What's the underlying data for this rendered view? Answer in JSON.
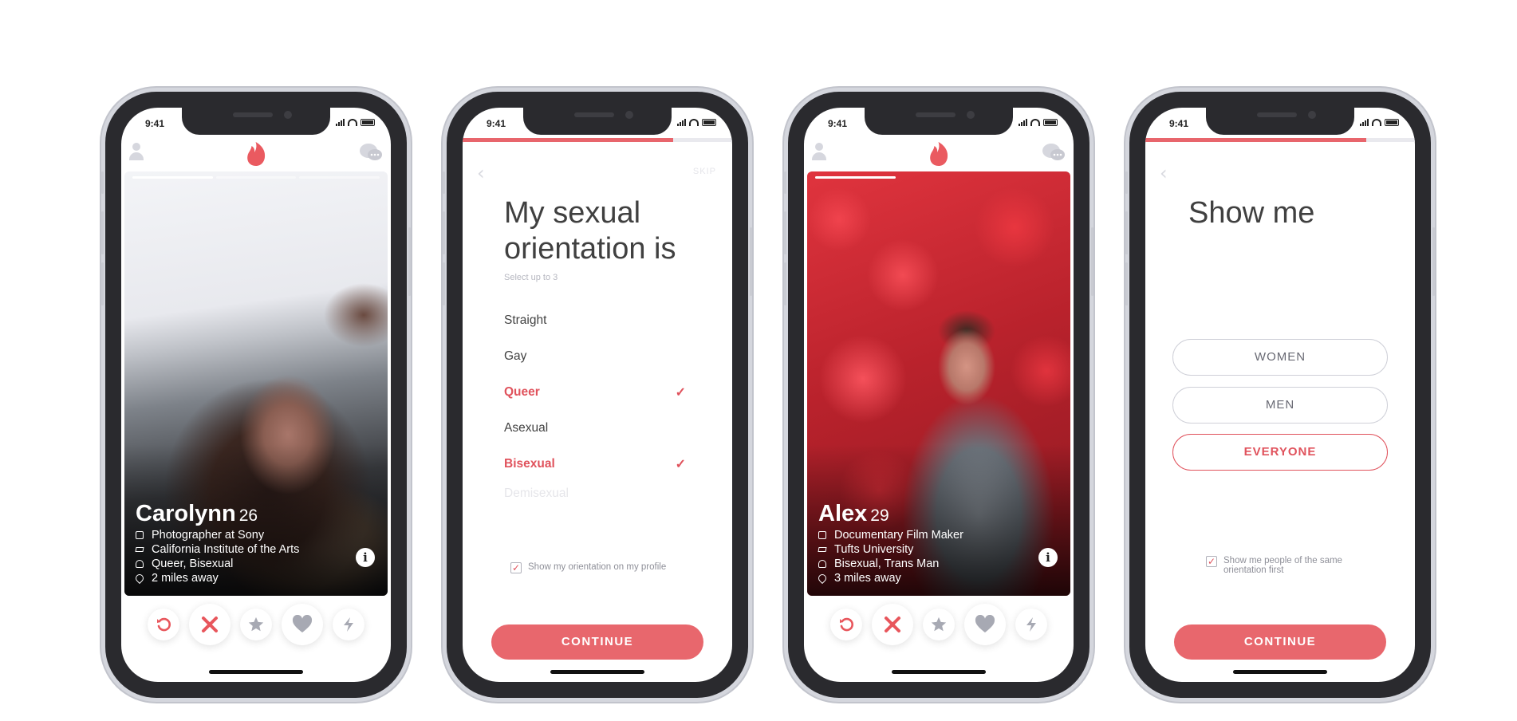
{
  "status_time": "9:41",
  "colors": {
    "brand": "#e8656c",
    "selected": "#e0525c",
    "button": "#e8676d"
  },
  "phone1": {
    "name": "Carolynn",
    "age": "26",
    "lines": [
      "Photographer at Sony",
      "California Institute of the Arts",
      "Queer, Bisexual",
      "2 miles away"
    ],
    "info_icon": "i"
  },
  "phone2": {
    "skip": "SKIP",
    "title_line1": "My sexual",
    "title_line2": "orientation is",
    "subtitle": "Select up to 3",
    "options": [
      {
        "label": "Straight",
        "selected": false
      },
      {
        "label": "Gay",
        "selected": false
      },
      {
        "label": "Queer",
        "selected": true
      },
      {
        "label": "Asexual",
        "selected": false
      },
      {
        "label": "Bisexual",
        "selected": true
      },
      {
        "label": "Demisexual",
        "selected": false
      }
    ],
    "checkbox_label": "Show my orientation on my profile",
    "checkbox_checked": true,
    "continue": "CONTINUE"
  },
  "phone3": {
    "name": "Alex",
    "age": "29",
    "lines": [
      "Documentary Film Maker",
      "Tufts University",
      "Bisexual, Trans Man",
      "3 miles away"
    ],
    "info_icon": "i"
  },
  "phone4": {
    "title": "Show me",
    "options": [
      {
        "label": "WOMEN",
        "selected": false
      },
      {
        "label": "MEN",
        "selected": false
      },
      {
        "label": "EVERYONE",
        "selected": true
      }
    ],
    "checkbox_label": "Show me people of the same orientation first",
    "checkbox_checked": true,
    "continue": "CONTINUE"
  },
  "icons": [
    "user-icon",
    "flame-icon",
    "chat-icon",
    "rewind-icon",
    "nope-icon",
    "super-like-icon",
    "like-icon",
    "boost-icon",
    "back-chevron-icon",
    "checkmark-icon"
  ]
}
